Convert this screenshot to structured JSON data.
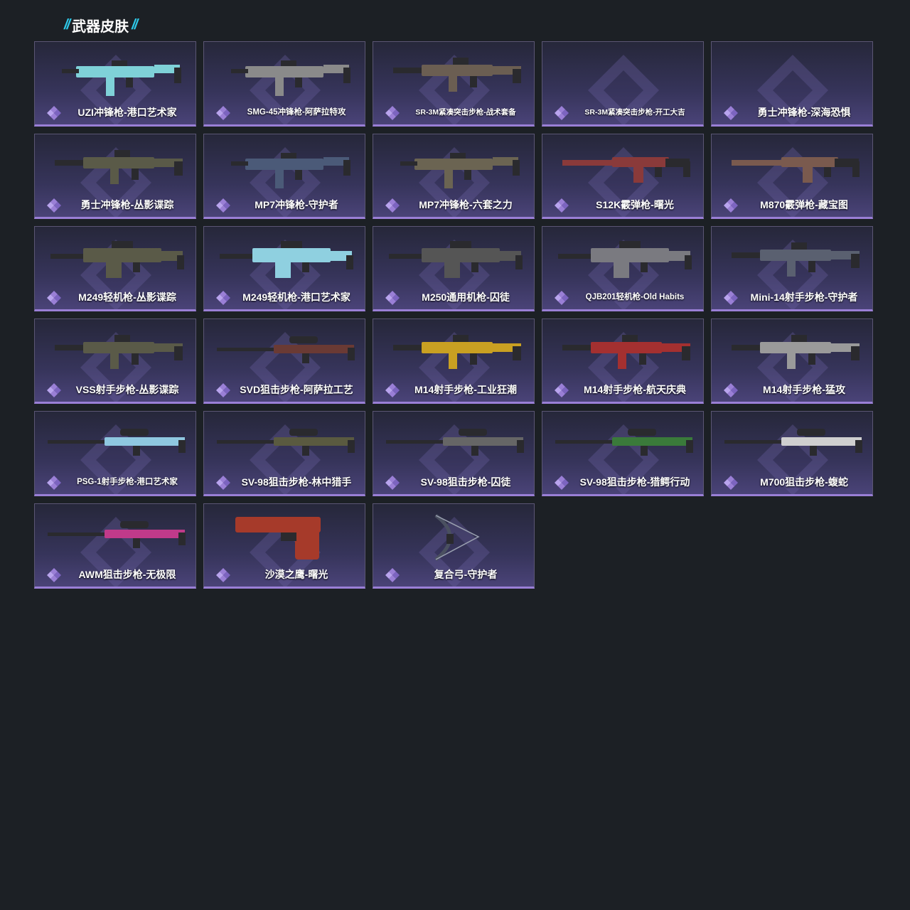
{
  "section": {
    "title": "武器皮肤",
    "deco": "//"
  },
  "colors": {
    "background": "#1c2025",
    "accent_cyan": "#2ec8e8",
    "rarity_purple": "#9a7fd6"
  },
  "skins": [
    {
      "name": "UZI冲锋枪-港口艺术家",
      "gun_icon": "smg-icon",
      "tone": "#7fd1d8",
      "size": "normal"
    },
    {
      "name": "SMG-45冲锋枪-阿萨拉特攻",
      "gun_icon": "smg-icon",
      "tone": "#8a8a8a",
      "size": "small"
    },
    {
      "name": "SR-3M紧凑突击步枪-战术套备",
      "gun_icon": "rifle-icon",
      "tone": "#6b5e52",
      "size": "tiny"
    },
    {
      "name": "SR-3M紧凑突击步枪-开工大吉",
      "gun_icon": "",
      "tone": "",
      "size": "tiny"
    },
    {
      "name": "勇士冲锋枪-深海恐惧",
      "gun_icon": "",
      "tone": "",
      "size": "normal"
    },
    {
      "name": "勇士冲锋枪-丛影谍踪",
      "gun_icon": "rifle-icon",
      "tone": "#5a5a48",
      "size": "normal"
    },
    {
      "name": "MP7冲锋枪-守护者",
      "gun_icon": "smg-icon",
      "tone": "#4b5a78",
      "size": "normal"
    },
    {
      "name": "MP7冲锋枪-六套之力",
      "gun_icon": "smg-icon",
      "tone": "#6b6452",
      "size": "normal"
    },
    {
      "name": "S12K霰弹枪-曙光",
      "gun_icon": "shotgun-icon",
      "tone": "#8a3a3a",
      "size": "normal"
    },
    {
      "name": "M870霰弹枪-藏宝图",
      "gun_icon": "shotgun-icon",
      "tone": "#7a5a4e",
      "size": "normal"
    },
    {
      "name": "M249轻机枪-丛影谍踪",
      "gun_icon": "lmg-icon",
      "tone": "#5a5a48",
      "size": "normal"
    },
    {
      "name": "M249轻机枪-港口艺术家",
      "gun_icon": "lmg-icon",
      "tone": "#8fd0e0",
      "size": "normal"
    },
    {
      "name": "M250通用机枪-囚徒",
      "gun_icon": "lmg-icon",
      "tone": "#555555",
      "size": "normal"
    },
    {
      "name": "QJB201轻机枪-Old Habits",
      "gun_icon": "lmg-icon",
      "tone": "#7a7a80",
      "size": "small"
    },
    {
      "name": "Mini-14射手步枪-守护者",
      "gun_icon": "rifle-icon",
      "tone": "#5a6070",
      "size": "normal"
    },
    {
      "name": "VSS射手步枪-丛影谍踪",
      "gun_icon": "rifle-icon",
      "tone": "#5a5a48",
      "size": "normal"
    },
    {
      "name": "SVD狙击步枪-阿萨拉工艺",
      "gun_icon": "sniper-icon",
      "tone": "#6a3a34",
      "size": "normal"
    },
    {
      "name": "M14射手步枪-工业狂潮",
      "gun_icon": "rifle-icon",
      "tone": "#c9a022",
      "size": "normal"
    },
    {
      "name": "M14射手步枪-航天庆典",
      "gun_icon": "rifle-icon",
      "tone": "#a43030",
      "size": "normal"
    },
    {
      "name": "M14射手步枪-猛攻",
      "gun_icon": "rifle-icon",
      "tone": "#9a9a9a",
      "size": "normal"
    },
    {
      "name": "PSG-1射手步枪-港口艺术家",
      "gun_icon": "sniper-icon",
      "tone": "#8fc8e0",
      "size": "small"
    },
    {
      "name": "SV-98狙击步枪-林中猎手",
      "gun_icon": "sniper-icon",
      "tone": "#5a5a40",
      "size": "normal"
    },
    {
      "name": "SV-98狙击步枪-囚徒",
      "gun_icon": "sniper-icon",
      "tone": "#666666",
      "size": "normal"
    },
    {
      "name": "SV-98狙击步枪-猎鳄行动",
      "gun_icon": "sniper-icon",
      "tone": "#3a7a3a",
      "size": "normal"
    },
    {
      "name": "M700狙击步枪-蝮蛇",
      "gun_icon": "sniper-icon",
      "tone": "#cfcfcf",
      "size": "normal"
    },
    {
      "name": "AWM狙击步枪-无极限",
      "gun_icon": "sniper-icon",
      "tone": "#c03a8a",
      "size": "normal"
    },
    {
      "name": "沙漠之鹰-曙光",
      "gun_icon": "pistol-icon",
      "tone": "#a63a2a",
      "size": "normal"
    },
    {
      "name": "复合弓-守护者",
      "gun_icon": "bow-icon",
      "tone": "#4a5060",
      "size": "normal"
    }
  ]
}
